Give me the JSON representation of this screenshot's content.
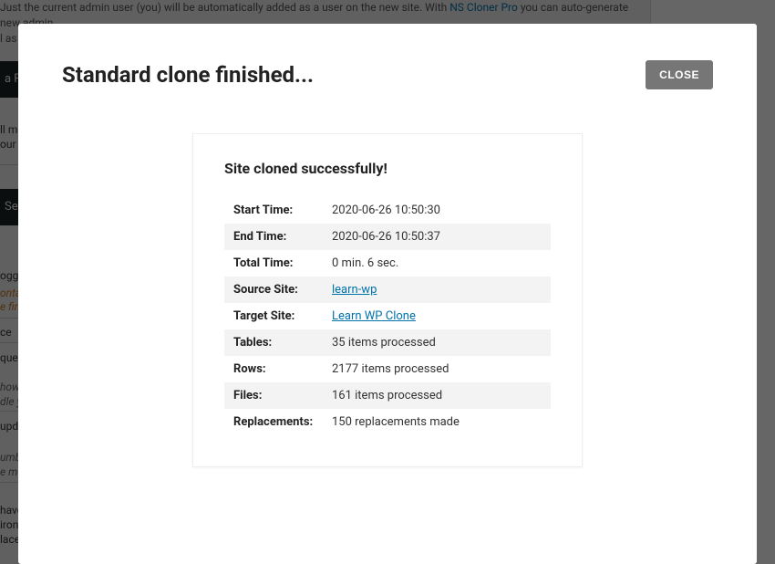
{
  "bg": {
    "topline1": "Just the current admin user (you) will be automatically added as a user on the new site. With ",
    "toplink": "NS Cloner Pro",
    "topline1b": " you can auto-generate new admin",
    "topline2": "l as have the option to clone all the existing users.",
    "bar1": "a Fil",
    "bar2": "Sett",
    "t_media1": "ll med",
    "t_media2": "our c",
    "t_logging": "ogging",
    "t_link1": "ontain",
    "t_link2": "e fin",
    "t_ce": "ce",
    "t_query": "query",
    "t_how": "how",
    "t_dle": "dle y",
    "t_update": "updat",
    "t_umber": "umber",
    "t_more": "e mo",
    "t_have": "have",
    "t_iron": "ironn",
    "t_lace": "lace"
  },
  "modal": {
    "title": "Standard clone finished...",
    "close_label": "CLOSE"
  },
  "card": {
    "title": "Site cloned successfully!",
    "rows": [
      {
        "label": "Start Time:",
        "value": "2020-06-26 10:50:30"
      },
      {
        "label": "End Time:",
        "value": "2020-06-26 10:50:37"
      },
      {
        "label": "Total Time:",
        "value": "0 min. 6 sec."
      },
      {
        "label": "Source Site:",
        "link": "learn-wp"
      },
      {
        "label": "Target Site:",
        "link": "Learn WP Clone"
      },
      {
        "label": "Tables:",
        "value": "35 items processed"
      },
      {
        "label": "Rows:",
        "value": "2177 items processed"
      },
      {
        "label": "Files:",
        "value": "161 items processed"
      },
      {
        "label": "Replacements:",
        "value": "150 replacements made"
      }
    ]
  }
}
